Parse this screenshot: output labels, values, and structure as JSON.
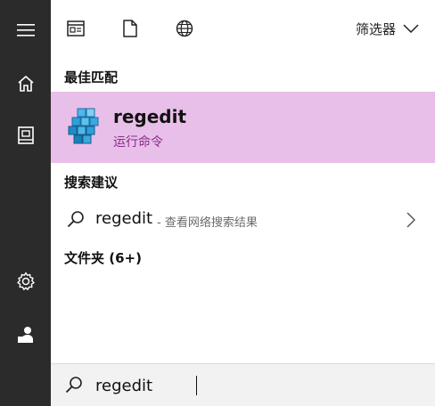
{
  "rail": {
    "items": [
      "hamburger-menu",
      "home",
      "documents",
      "settings",
      "user"
    ]
  },
  "toolbar": {
    "filter_label": "筛选器"
  },
  "best_match": {
    "section_title": "最佳匹配",
    "app_name": "regedit",
    "app_subtitle": "运行命令"
  },
  "suggestions": {
    "section_title": "搜索建议",
    "query": "regedit",
    "hint": " - 查看网络搜索结果"
  },
  "folders": {
    "section_title": "文件夹 (6+)"
  },
  "search": {
    "value": "regedit"
  },
  "colors": {
    "rail_bg": "#2b2b2b",
    "highlight_bg": "#e8bfe8",
    "subtitle": "#8a2b8a"
  }
}
